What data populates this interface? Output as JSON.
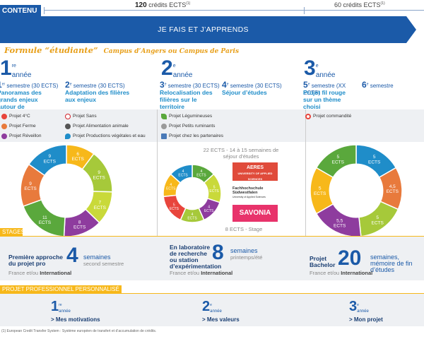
{
  "header": {
    "tab": "CONTENU",
    "credits_left": "120",
    "credits_left_unit": "crédits ECTS",
    "credits_left_note": "(1)",
    "credits_right": "60 crédits ECTS",
    "credits_right_note": "(1)",
    "banner": "JE FAIS ET J’APPRENDS",
    "formule": "Formule “étudiante”",
    "formule_sub": "Campus d’Angers ou Campus de Paris"
  },
  "years": [
    {
      "num": "1",
      "sup": "re",
      "label": "année",
      "sem_a": {
        "n": "1",
        "sup": "er",
        "text": "semestre (30 ECTS)",
        "sub": "Panoramas des grands enjeux autour de l’alimentation"
      },
      "sem_b": {
        "n": "2",
        "sup": "e",
        "text": "semestre (30 ECTS)",
        "sub": "Adaptation des filières aux enjeux"
      }
    },
    {
      "num": "2",
      "sup": "e",
      "label": "année",
      "sem_a": {
        "n": "3",
        "sup": "e",
        "text": "semestre (30 ECTS)",
        "sub": "Relocalisation des filières sur le territoire"
      },
      "sem_b": {
        "n": "4",
        "sup": "e",
        "text": "semestre (30 ECTS)",
        "sub": "Séjour d’études"
      }
    },
    {
      "num": "3",
      "sup": "e",
      "label": "année",
      "sem_a": {
        "n": "5",
        "sup": "e",
        "text": "semestre (XX ECTS)",
        "sub": "Projet fil rouge sur un thème choisi"
      },
      "sem_b": {
        "n": "6",
        "sup": "e",
        "text": "semestre",
        "sub": ""
      }
    }
  ],
  "projects": {
    "col1": [
      {
        "icon": "gear-icon",
        "label": "Projet 4°C",
        "color": "#e8453c"
      },
      {
        "icon": "farm-icon",
        "label": "Projet Ferme",
        "color": "#e87a3c"
      },
      {
        "icon": "people-icon",
        "label": "Projet Réveillon",
        "color": "#8e3c9e"
      }
    ],
    "col2": [
      {
        "icon": "no-sign-icon",
        "label": "Projet Sans",
        "color": "#d2232a"
      },
      {
        "icon": "food-icon",
        "label": "Projet Alimentation animale",
        "color": "#555555"
      },
      {
        "icon": "drop-icon",
        "label": "Projet Productions végétales et eau",
        "color": "#1f8dc9"
      }
    ],
    "col3": [
      {
        "icon": "leaf-icon",
        "label": "Projet Légumineuses",
        "color": "#5aa83c"
      },
      {
        "icon": "goat-icon",
        "label": "Projet Petits ruminants",
        "color": "#7a7a7a"
      },
      {
        "icon": "buildings-icon",
        "label": "Projet chez les partenaires",
        "color": "#4a7ab8"
      }
    ],
    "col4": [
      {
        "icon": "target-icon",
        "label": "Projet commandité",
        "color": "#e8453c"
      }
    ]
  },
  "middle": {
    "top_note": "22 ECTS - 14 à 15 semaines de séjour d’études",
    "bottom_note": "8 ECTS - Stage",
    "logos": [
      {
        "name": "AERES",
        "sub": "UNIVERSITY OF APPLIED SCIENCES",
        "color": "#e04b3b"
      },
      {
        "name": "Fachhochschule Südwestfalen",
        "sub": "University of Applied Sciences",
        "color": "#ffffff"
      },
      {
        "name": "SAVONIA",
        "sub": "",
        "color": "#e8336b"
      }
    ]
  },
  "chart_data": [
    {
      "type": "pie",
      "style": "donut",
      "labels": [
        "6 ECTS",
        "9 ECTS",
        "7 ECTS",
        "8 ECTS",
        "11 ECTS",
        "9 ECTS",
        "9 ECTS"
      ],
      "slice_text": [
        [
          "6",
          "ECTS"
        ],
        [
          "9",
          "ECTS"
        ],
        [
          "7",
          "ECTS"
        ],
        [
          "8",
          "ECTS"
        ],
        [
          "11",
          "ECTS"
        ],
        [
          "9",
          "ECTS"
        ],
        [
          "9",
          "ECTS"
        ]
      ],
      "values": [
        6,
        9,
        7,
        8,
        11,
        9,
        9
      ],
      "colors": [
        "#f7b81a",
        "#a6c93a",
        "#c9d93a",
        "#8e3c9e",
        "#5aa83c",
        "#e87a3c",
        "#1f8dc9"
      ]
    },
    {
      "type": "pie",
      "style": "donut",
      "labels": [
        "4 ECTS",
        "5 ECTS",
        "4 ECTS",
        "4 ECTS",
        "5 ECTS",
        "4 ECTS",
        "4 ECTS"
      ],
      "slice_text": [
        [
          "4",
          "ECTS"
        ],
        [
          "5",
          "ECTS"
        ],
        [
          "4",
          "ECTS"
        ],
        [
          "4",
          "ECTS"
        ],
        [
          "5",
          "ECTS"
        ],
        [
          "4",
          "ECTS"
        ],
        [
          "4",
          "ECTS"
        ]
      ],
      "values": [
        4,
        5,
        4,
        4,
        5,
        4,
        4
      ],
      "colors": [
        "#5aa83c",
        "#c9d93a",
        "#8e3c9e",
        "#a6c93a",
        "#e8453c",
        "#f7b81a",
        "#1f8dc9"
      ]
    },
    {
      "type": "pie",
      "style": "donut",
      "labels": [
        "5 ECTS",
        "4.5 ECTS",
        "5 ECTS",
        "5.5 ECTS",
        "5 ECTS",
        "5 ECTS"
      ],
      "slice_text": [
        [
          "5",
          "ECTS"
        ],
        [
          "4,5",
          "ECTS"
        ],
        [
          "5",
          "ECTS"
        ],
        [
          "5,5",
          "ECTS"
        ],
        [
          "5",
          "ECTS"
        ],
        [
          "5",
          "ECTS"
        ]
      ],
      "values": [
        5,
        4.5,
        5,
        5.5,
        5,
        5
      ],
      "colors": [
        "#1f8dc9",
        "#e87a3c",
        "#a6c93a",
        "#8e3c9e",
        "#f7b81a",
        "#5aa83c"
      ]
    }
  ],
  "stages": {
    "tab": "STAGES",
    "items": [
      {
        "title": "Première approche du projet pro",
        "num": "4",
        "unit": "semaines",
        "sub": "second semestre",
        "place": "France et/ou",
        "place_b": "International"
      },
      {
        "title": "En laboratoire de recherche ou station d’expérimentation",
        "num": "8",
        "unit": "semaines",
        "sub": "printemps/été",
        "place": "France et/ou",
        "place_b": "International"
      },
      {
        "title": "Projet Bachelor",
        "num": "20",
        "unit": "semaines, mémoire de fin d’études",
        "sub": "",
        "place": "France et/ou",
        "place_b": "International"
      }
    ]
  },
  "ppp": {
    "tab": "PROJET PROFESSIONNEL PERSONNALISÉ",
    "items": [
      {
        "num": "1",
        "sup": "re",
        "label": "année",
        "text": "> Mes motivations"
      },
      {
        "num": "2",
        "sup": "e",
        "label": "année",
        "text": "> Mes valeurs"
      },
      {
        "num": "3",
        "sup": "e",
        "label": "année",
        "text": "> Mon projet"
      }
    ]
  },
  "footnote": "(1) European Credit Transfer System : Système européen de transfert et d’accumulation de crédits."
}
